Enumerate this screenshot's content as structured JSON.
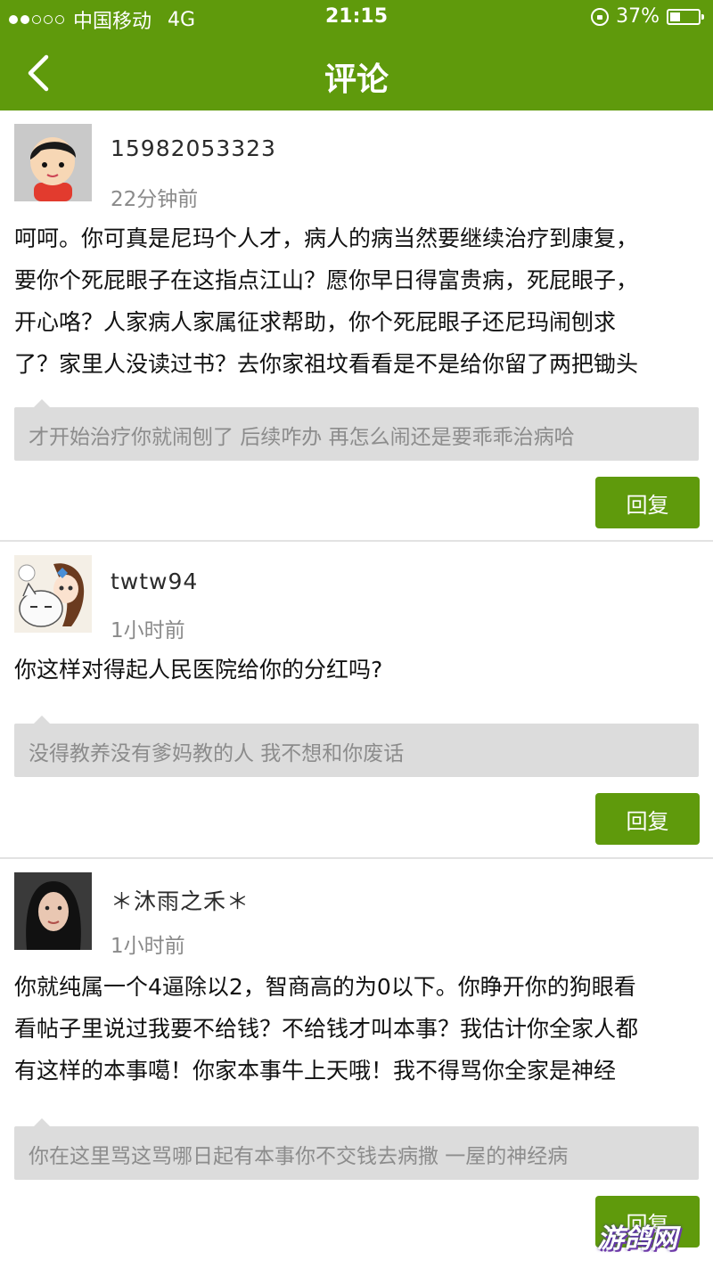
{
  "status_bar": {
    "carrier": "中国移动",
    "network": "4G",
    "time": "21:15",
    "battery_percent": "37%",
    "battery_level": 0.37
  },
  "nav": {
    "title": "评论",
    "back_icon": "chevron-left-icon"
  },
  "colors": {
    "brand_green": "#5f9a0c",
    "reply_bg": "#dcdcdc"
  },
  "comments": [
    {
      "username": "15982053323",
      "time": "22分钟前",
      "lines": [
        "呵呵。你可真是尼玛个人才，病人的病当然要继续治疗到康复，",
        "要你个死屁眼子在这指点江山？愿你早日得富贵病，死屁眼子，",
        "开心咯？人家病人家属征求帮助，你个死屁眼子还尼玛闹刨求",
        "了？家里人没读过书？去你家祖坟看看是不是给你留了两把锄头"
      ],
      "reply": "才开始治疗你就闹刨了 后续咋办 再怎么闹还是要乖乖治病哈",
      "reply_button": "回复"
    },
    {
      "username": "twtw94",
      "time": "1小时前",
      "lines": [
        "你这样对得起人民医院给你的分红吗?"
      ],
      "reply": "没得教养没有爹妈教的人 我不想和你废话",
      "reply_button": "回复"
    },
    {
      "username": "＊沐雨之禾＊",
      "time": "1小时前",
      "lines": [
        "你就纯属一个4逼除以2，智商高的为0以下。你睁开你的狗眼看",
        "看帖子里说过我要不给钱？不给钱才叫本事？我估计你全家人都",
        "有这样的本事噶！你家本事牛上天哦！我不得骂你全家是神经"
      ],
      "reply": "你在这里骂这骂哪日起有本事你不交钱去病撒 一屋的神经病",
      "reply_button": "回复"
    }
  ],
  "watermark": "游鸽网"
}
